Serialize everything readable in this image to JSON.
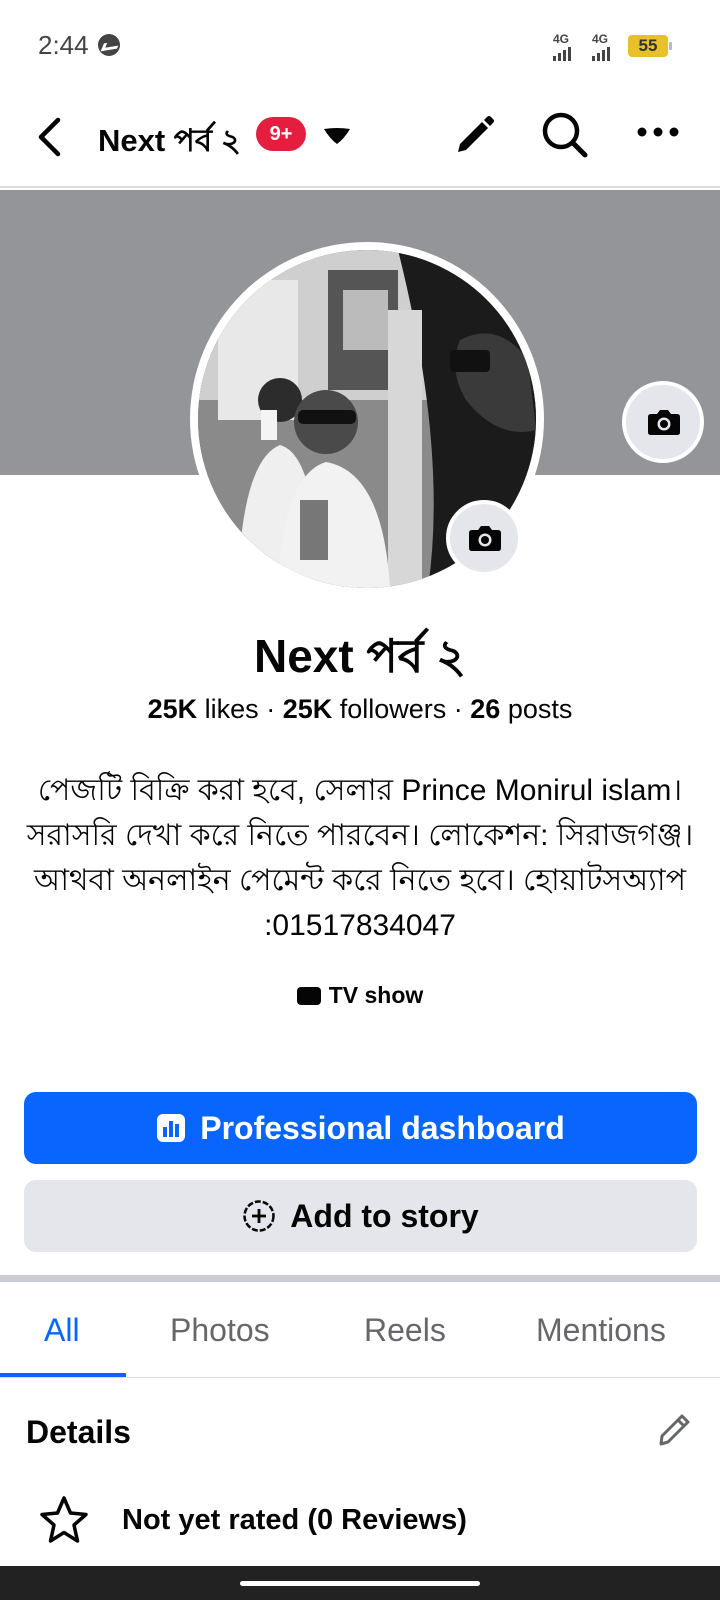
{
  "status_bar": {
    "time": "2:44",
    "network_1": "4G",
    "network_2": "4G",
    "battery": "55"
  },
  "nav": {
    "title": "Next পর্ব ২",
    "badge": "9+"
  },
  "profile": {
    "name": "Next পর্ব ২",
    "likes_count": "25K",
    "likes_label": " likes · ",
    "followers_count": "25K",
    "followers_label": " followers · ",
    "posts_count": "26",
    "posts_label": " posts",
    "bio": "পেজটি বিক্রি করা হবে, সেলার Prince Monirul islam। সরাসরি দেখা করে নিতে পারবেন। লোকেশন: সিরাজগঞ্জ। আথবা অনলাইন পেমেন্ট করে নিতে হবে। হোয়াটসঅ্যাপ :01517834047",
    "category": "TV show"
  },
  "buttons": {
    "professional_dashboard": "Professional dashboard",
    "add_to_story": "Add to story"
  },
  "tabs": [
    "All",
    "Photos",
    "Reels",
    "Mentions"
  ],
  "details": {
    "heading": "Details",
    "rating": "Not yet rated (0 Reviews)"
  },
  "colors": {
    "accent": "#0866ff",
    "badge": "#e41e3f",
    "cover": "#939599",
    "secondary_button": "#e4e6eb"
  }
}
